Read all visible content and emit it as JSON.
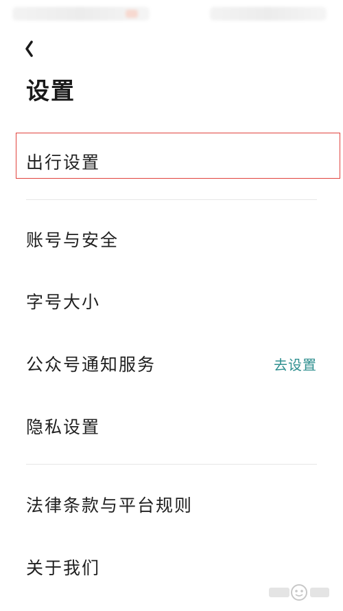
{
  "header": {
    "title": "设置"
  },
  "settings": {
    "travel": "出行设置",
    "account": "账号与安全",
    "font_size": "字号大小",
    "official_account": "公众号通知服务",
    "official_account_action": "去设置",
    "privacy": "隐私设置",
    "legal": "法律条款与平台规则",
    "about": "关于我们"
  },
  "colors": {
    "accent": "#2f8f8f",
    "highlight": "#e0403a",
    "divider": "#e6e6e6"
  }
}
